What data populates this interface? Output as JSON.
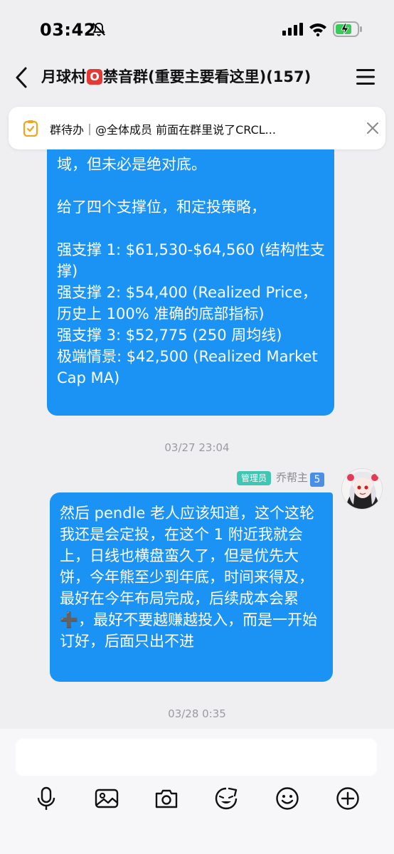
{
  "status_bar": {
    "time": "03:42"
  },
  "nav": {
    "title_prefix": "月球村",
    "title_suffix": "禁音群(重要主要看这里)(157)"
  },
  "todo": {
    "text": "群待办｜@全体成员  前面在群里说了CRCL..."
  },
  "messages": [
    {
      "lines": [
        "域，但未必是绝对底。",
        "",
        "给了四个支撑位，和定投策略，",
        "",
        "强支撑 1: $61,530-$64,560 (结构性支撑)",
        "强支撑 2: $54,400 (Realized Price，历史上 100% 准确的底部指标)",
        "强支撑 3: $52,775 (250 周均线)",
        "极端情景: $42,500 (Realized Market Cap MA)"
      ]
    },
    {
      "timestamp": "03/27 23:04",
      "admin_badge": "管理员",
      "sender": "乔帮主",
      "sender_level": "5",
      "text": "然后 pendle 老人应该知道，这个这轮我还是会定投，在这个 1 附近我就会上，日线也横盘蛮久了，但是优先大饼，今年熊至少到年底，时间来得及，最好在今年布局完成，后续成本会累➕，最好不要越赚越投入，而是一开始订好，后面只出不进"
    }
  ],
  "timestamp_2": "03/28 0:35",
  "colors": {
    "bubble": "#1b93f5",
    "background": "#efeff2",
    "admin_badge": "#3fc7b4"
  }
}
